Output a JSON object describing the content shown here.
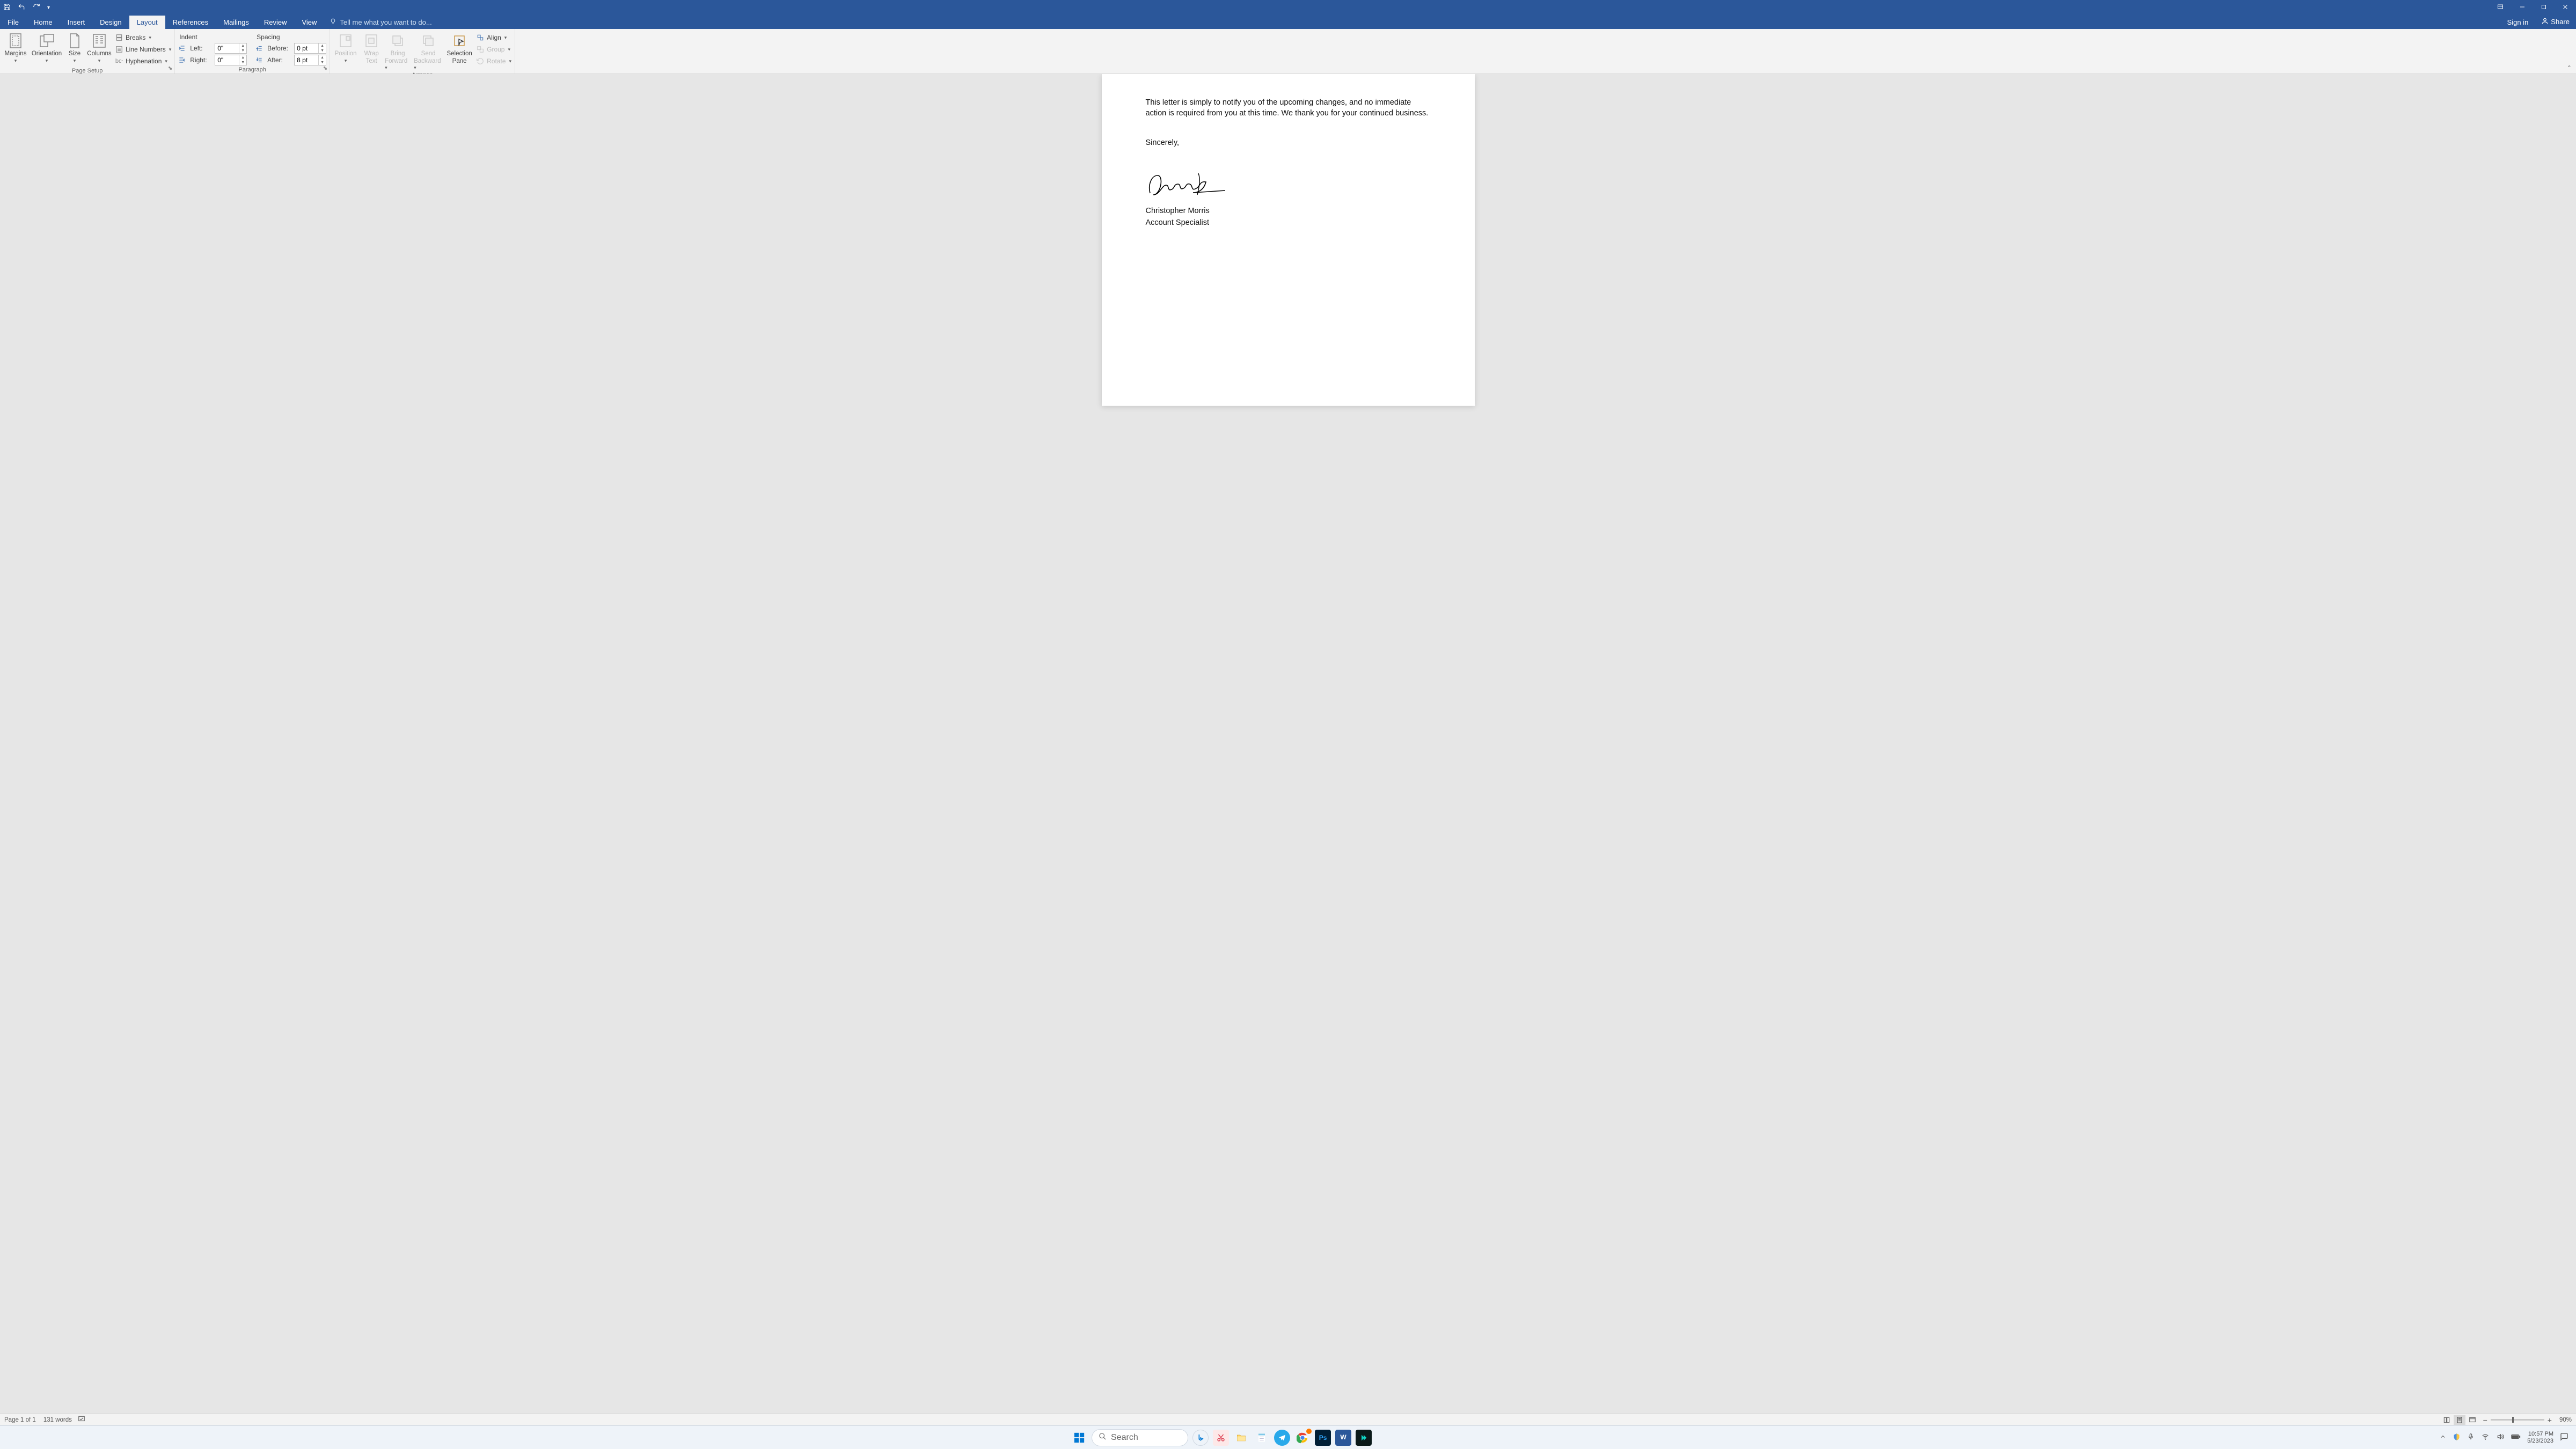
{
  "titlebar": {
    "qat": {
      "save": "Save",
      "undo": "Undo",
      "redo": "Redo"
    }
  },
  "tabs": {
    "file": "File",
    "home": "Home",
    "insert": "Insert",
    "design": "Design",
    "layout": "Layout",
    "references": "References",
    "mailings": "Mailings",
    "review": "Review",
    "view": "View",
    "tellme_placeholder": "Tell me what you want to do...",
    "signin": "Sign in",
    "share": "Share"
  },
  "ribbon": {
    "page_setup": {
      "label": "Page Setup",
      "margins": "Margins",
      "orientation": "Orientation",
      "size": "Size",
      "columns": "Columns",
      "breaks": "Breaks",
      "line_numbers": "Line Numbers",
      "hyphenation": "Hyphenation"
    },
    "indent": {
      "head": "Indent",
      "left": "Left:",
      "right": "Right:",
      "left_val": "0\"",
      "right_val": "0\""
    },
    "spacing": {
      "head": "Spacing",
      "before": "Before:",
      "after": "After:",
      "before_val": "0 pt",
      "after_val": "8 pt"
    },
    "paragraph_label": "Paragraph",
    "arrange": {
      "label": "Arrange",
      "position": "Position",
      "wrap": "Wrap Text",
      "wrap_l1": "Wrap",
      "wrap_l2": "Text",
      "bring": "Bring Forward",
      "bring_l1": "Bring",
      "bring_l2": "Forward",
      "send": "Send Backward",
      "send_l1": "Send",
      "send_l2": "Backward",
      "selection": "Selection Pane",
      "selection_l1": "Selection",
      "selection_l2": "Pane",
      "align": "Align",
      "group": "Group",
      "rotate": "Rotate"
    }
  },
  "document": {
    "paragraph1": "This letter is simply to notify you of the upcoming changes, and no immediate action is required from you at this time. We thank you for your continued business.",
    "closing": "Sincerely,",
    "name": "Christopher Morris",
    "title": "Account Specialist"
  },
  "statusbar": {
    "page": "Page 1 of 1",
    "words": "131 words",
    "zoom": "90%"
  },
  "taskbar": {
    "search_placeholder": "Search",
    "time": "10:57 PM",
    "date": "5/23/2023"
  }
}
